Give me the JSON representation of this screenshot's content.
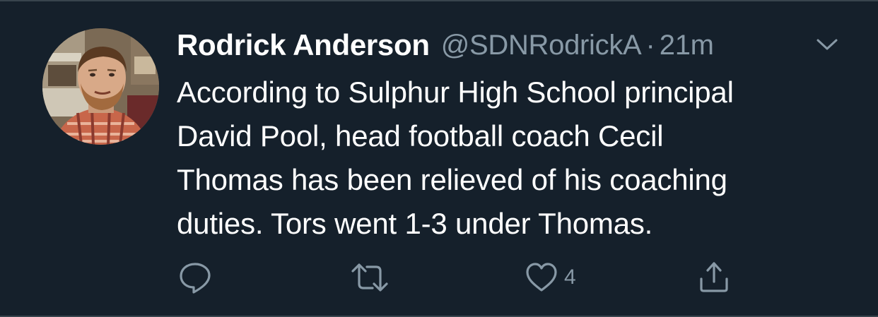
{
  "tweet": {
    "display_name": "Rodrick Anderson",
    "handle": "@SDNRodrickA",
    "separator": "·",
    "time": "21m",
    "text_lines": [
      "According to Sulphur High School principal",
      "David Pool, head football coach Cecil",
      "Thomas has been relieved of his coaching",
      "duties. Tors went 1-3 under Thomas."
    ],
    "like_count": "4"
  },
  "icons": {
    "avatar": "profile-photo",
    "menu": "chevron-down-icon",
    "reply": "reply-icon",
    "retweet": "retweet-icon",
    "like": "heart-icon",
    "share": "share-icon"
  },
  "colors": {
    "background": "#15202b",
    "primary_text": "#ffffff",
    "secondary_text": "#8899a6",
    "border": "#38444d"
  }
}
